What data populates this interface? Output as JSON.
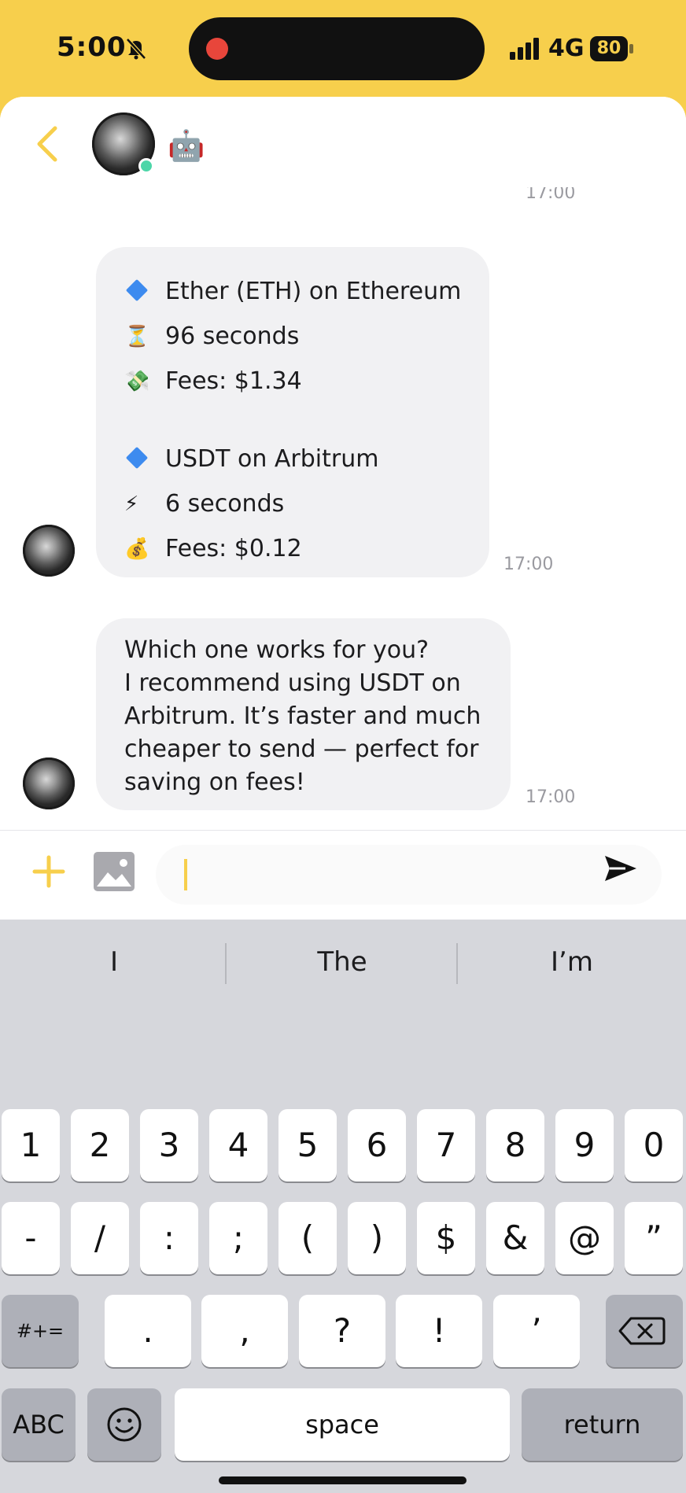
{
  "status_bar": {
    "time": "5:00",
    "network": "4G",
    "battery": "80",
    "icons": [
      "bell-slash-icon",
      "signal-bars-icon",
      "battery-icon",
      "screen-recording-icon"
    ]
  },
  "header": {
    "robot_emoji": "🤖",
    "icons": [
      "chevron-left-icon",
      "avatar",
      "online-status-dot"
    ]
  },
  "messages": [
    {
      "id": "partial",
      "timestamp": "17:00"
    },
    {
      "id": "options",
      "lines": [
        {
          "icon": "diamond",
          "text": "Ether (ETH) on Ethereum"
        },
        {
          "icon": "⏳",
          "text": "96 seconds"
        },
        {
          "icon": "💸",
          "text": "Fees: $1.34"
        },
        {
          "icon": "diamond",
          "text": "USDT on Arbitrum"
        },
        {
          "icon": "⚡",
          "text": "6 seconds"
        },
        {
          "icon": "💰",
          "text": "Fees: $0.12"
        }
      ],
      "timestamp": "17:00"
    },
    {
      "id": "recommend",
      "lines": [
        "Which one works for you?",
        "I recommend using USDT on",
        "Arbitrum. It’s faster and much",
        "cheaper to send — perfect for",
        "saving on fees!"
      ],
      "timestamp": "17:00"
    }
  ],
  "input_bar": {
    "value": "",
    "icons": [
      "plus-icon",
      "image-icon",
      "send-icon"
    ]
  },
  "keyboard": {
    "suggestions": [
      "I",
      "The",
      "I’m"
    ],
    "row1": [
      "1",
      "2",
      "3",
      "4",
      "5",
      "6",
      "7",
      "8",
      "9",
      "0"
    ],
    "row2": [
      "-",
      "/",
      ":",
      ";",
      "(",
      ")",
      "$",
      "&",
      "@",
      "”"
    ],
    "row3_left": "#+=",
    "row3": [
      ".",
      ",",
      "?",
      "!",
      "’"
    ],
    "abc": "ABC",
    "space": "space",
    "return": "return",
    "icons": [
      "backspace-icon",
      "emoji-icon",
      "globe-icon",
      "microphone-icon"
    ]
  },
  "colors": {
    "accent": "#f7cf4c",
    "bubble": "#f1f1f3",
    "online": "#4cd6a8",
    "keyboard_bg": "#d6d7dc"
  }
}
